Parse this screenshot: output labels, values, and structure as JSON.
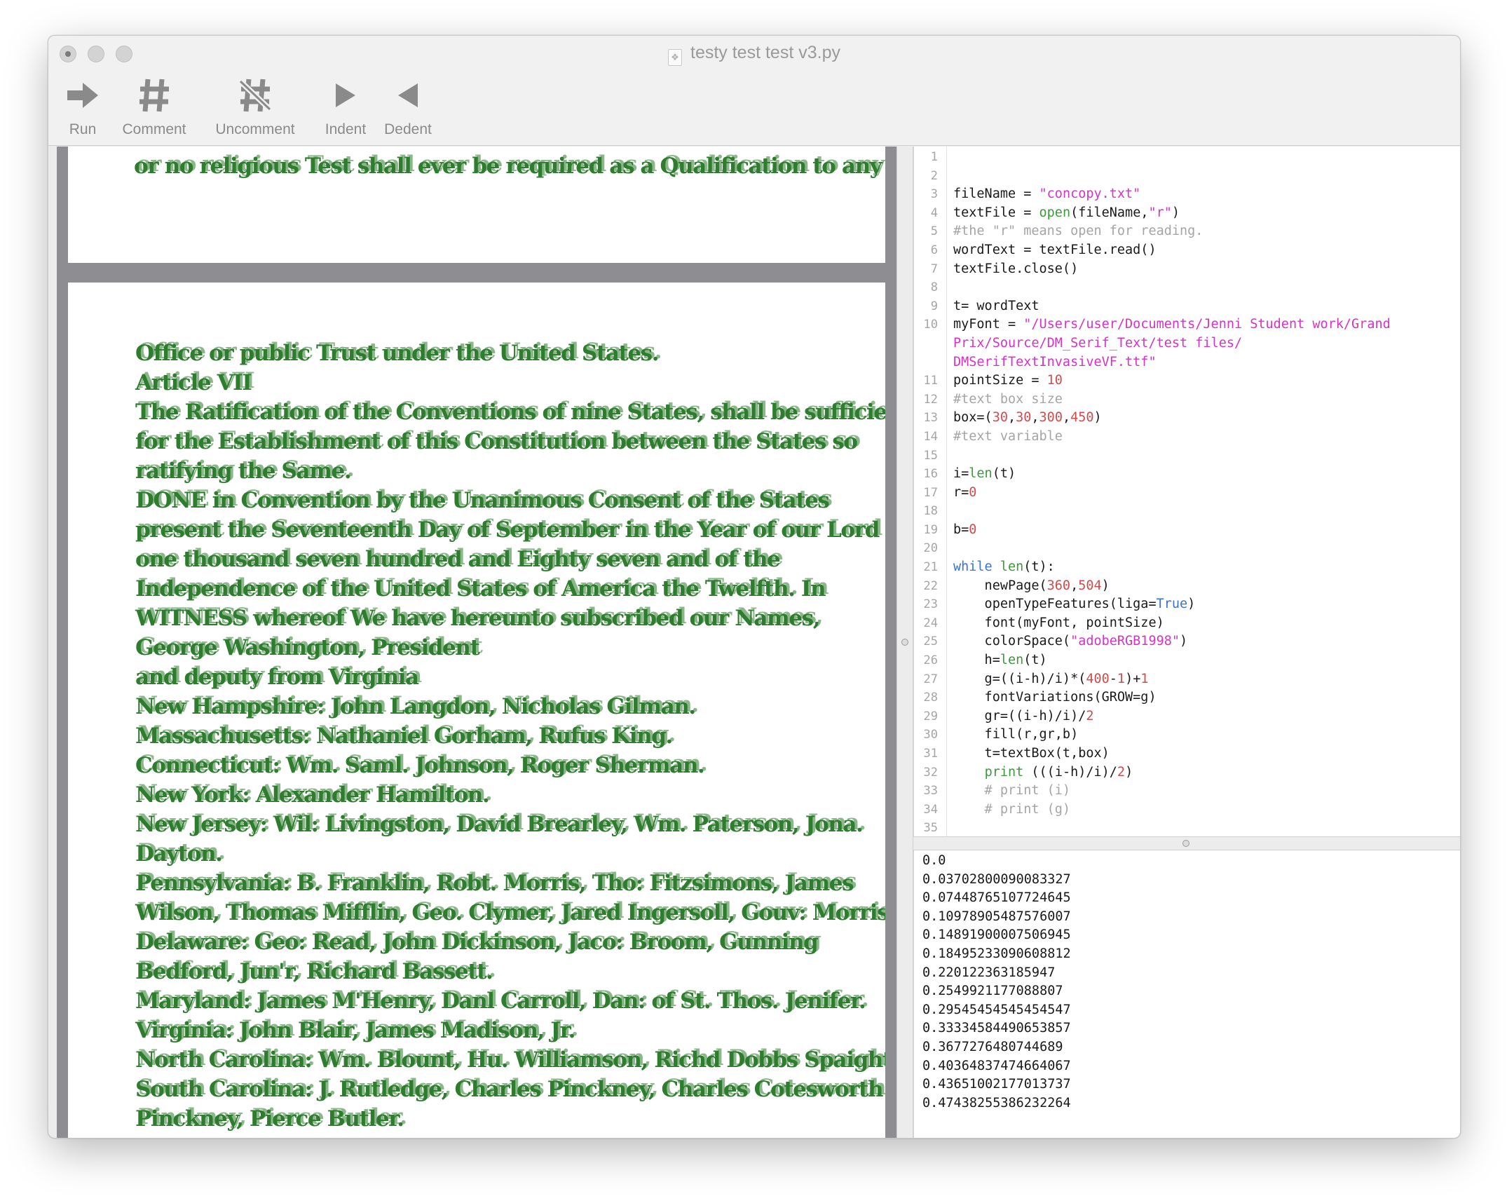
{
  "window": {
    "title": "testy test test v3.py"
  },
  "toolbar": {
    "run_label": "Run",
    "comment_label": "Comment",
    "uncomment_label": "Uncomment",
    "indent_label": "Indent",
    "dedent_label": "Dedent",
    "icons": [
      "run-arrow-icon",
      "comment-hash-icon",
      "uncomment-hash-icon",
      "indent-triangle-icon",
      "dedent-triangle-icon"
    ]
  },
  "canvas": {
    "text_color": "#2e7d2e",
    "page1_line": "or no religious Test shall ever be required as a Qualification to any",
    "page2_lines": [
      "Office or public Trust under the United States.",
      "Article VII",
      "The Ratification of the Conventions of nine States, shall be sufficient",
      "for the Establishment of this Constitution between the States so",
      "ratifying the Same.",
      "DONE in Convention by the Unanimous Consent of the States",
      "present the Seventeenth Day of September in the Year of our Lord",
      "one thousand seven hundred and Eighty seven and of the",
      "Independence of the United States of America the Twelfth. In",
      "WITNESS whereof We have hereunto subscribed our Names,",
      "George Washington, President",
      "and deputy from Virginia",
      "New Hampshire: John Langdon, Nicholas Gilman.",
      "Massachusetts: Nathaniel Gorham, Rufus King.",
      "Connecticut: Wm. Saml. Johnson, Roger Sherman.",
      "New York: Alexander Hamilton.",
      "New Jersey: Wil: Livingston, David Brearley, Wm. Paterson, Jona.",
      "Dayton.",
      "Pennsylvania: B. Franklin, Robt. Morris, Tho: Fitzsimons, James",
      "Wilson, Thomas Mifflin, Geo. Clymer, Jared Ingersoll, Gouv: Morris.",
      "Delaware: Geo: Read, John Dickinson, Jaco: Broom, Gunning",
      "Bedford, Jun'r, Richard Bassett.",
      "Maryland: James M'Henry, Danl Carroll, Dan: of St. Thos. Jenifer.",
      "Virginia: John Blair, James Madison, Jr.",
      "North Carolina: Wm. Blount, Hu. Williamson, Richd Dobbs Spaight.",
      "South Carolina: J. Rutledge, Charles Pinckney, Charles Cotesworth",
      "Pinckney, Pierce Butler."
    ]
  },
  "editor": {
    "colors": {
      "string": "#d633c6",
      "function": "#3b9a3b",
      "number": "#d14c4c",
      "keyword": "#3a72d8",
      "comment": "#a5a5a5"
    },
    "lines": [
      {
        "n": "1",
        "tokens": []
      },
      {
        "n": "2",
        "tokens": []
      },
      {
        "n": "3",
        "tokens": [
          {
            "t": "fileName = ",
            "c": ""
          },
          {
            "t": "\"concopy.txt\"",
            "c": "str"
          }
        ]
      },
      {
        "n": "4",
        "tokens": [
          {
            "t": "textFile = ",
            "c": ""
          },
          {
            "t": "open",
            "c": "fn"
          },
          {
            "t": "(fileName,",
            "c": ""
          },
          {
            "t": "\"r\"",
            "c": "str"
          },
          {
            "t": ")",
            "c": ""
          }
        ]
      },
      {
        "n": "5",
        "tokens": [
          {
            "t": "#the \"r\" means open for reading.",
            "c": "com"
          }
        ]
      },
      {
        "n": "6",
        "tokens": [
          {
            "t": "wordText = textFile.read()",
            "c": ""
          }
        ]
      },
      {
        "n": "7",
        "tokens": [
          {
            "t": "textFile.close()",
            "c": ""
          }
        ]
      },
      {
        "n": "8",
        "tokens": []
      },
      {
        "n": "9",
        "tokens": [
          {
            "t": "t= wordText",
            "c": ""
          }
        ]
      },
      {
        "n": "10",
        "tokens": [
          {
            "t": "myFont = ",
            "c": ""
          },
          {
            "t": "\"/Users/user/Documents/Jenni Student work/Grand",
            "c": "str"
          }
        ]
      },
      {
        "n": "",
        "tokens": [
          {
            "t": "Prix/Source/DM_Serif_Text/test files/",
            "c": "str"
          }
        ]
      },
      {
        "n": "",
        "tokens": [
          {
            "t": "DMSerifTextInvasiveVF.ttf\"",
            "c": "str"
          }
        ]
      },
      {
        "n": "11",
        "tokens": [
          {
            "t": "pointSize = ",
            "c": ""
          },
          {
            "t": "10",
            "c": "num"
          }
        ]
      },
      {
        "n": "12",
        "tokens": [
          {
            "t": "#text box size",
            "c": "com"
          }
        ]
      },
      {
        "n": "13",
        "tokens": [
          {
            "t": "box=(",
            "c": ""
          },
          {
            "t": "30",
            "c": "num"
          },
          {
            "t": ",",
            "c": ""
          },
          {
            "t": "30",
            "c": "num"
          },
          {
            "t": ",",
            "c": ""
          },
          {
            "t": "300",
            "c": "num"
          },
          {
            "t": ",",
            "c": ""
          },
          {
            "t": "450",
            "c": "num"
          },
          {
            "t": ")",
            "c": ""
          }
        ]
      },
      {
        "n": "14",
        "tokens": [
          {
            "t": "#text variable",
            "c": "com"
          }
        ]
      },
      {
        "n": "15",
        "tokens": []
      },
      {
        "n": "16",
        "tokens": [
          {
            "t": "i=",
            "c": ""
          },
          {
            "t": "len",
            "c": "fn"
          },
          {
            "t": "(t)",
            "c": ""
          }
        ]
      },
      {
        "n": "17",
        "tokens": [
          {
            "t": "r=",
            "c": ""
          },
          {
            "t": "0",
            "c": "num"
          }
        ]
      },
      {
        "n": "18",
        "tokens": []
      },
      {
        "n": "19",
        "tokens": [
          {
            "t": "b=",
            "c": ""
          },
          {
            "t": "0",
            "c": "num"
          }
        ]
      },
      {
        "n": "20",
        "tokens": []
      },
      {
        "n": "21",
        "tokens": [
          {
            "t": "while",
            "c": "kw"
          },
          {
            "t": " ",
            "c": ""
          },
          {
            "t": "len",
            "c": "fn"
          },
          {
            "t": "(t):",
            "c": ""
          }
        ]
      },
      {
        "n": "22",
        "tokens": [
          {
            "t": "    newPage(",
            "c": ""
          },
          {
            "t": "360",
            "c": "num"
          },
          {
            "t": ",",
            "c": ""
          },
          {
            "t": "504",
            "c": "num"
          },
          {
            "t": ")",
            "c": ""
          }
        ]
      },
      {
        "n": "23",
        "tokens": [
          {
            "t": "    openTypeFeatures(liga=",
            "c": ""
          },
          {
            "t": "True",
            "c": "kw"
          },
          {
            "t": ")",
            "c": ""
          }
        ]
      },
      {
        "n": "24",
        "tokens": [
          {
            "t": "    font(myFont, pointSize)",
            "c": ""
          }
        ]
      },
      {
        "n": "25",
        "tokens": [
          {
            "t": "    colorSpace(",
            "c": ""
          },
          {
            "t": "\"adobeRGB1998\"",
            "c": "str"
          },
          {
            "t": ")",
            "c": ""
          }
        ]
      },
      {
        "n": "26",
        "tokens": [
          {
            "t": "    h=",
            "c": ""
          },
          {
            "t": "len",
            "c": "fn"
          },
          {
            "t": "(t)",
            "c": ""
          }
        ]
      },
      {
        "n": "27",
        "tokens": [
          {
            "t": "    g=((i-h)/i)*(",
            "c": ""
          },
          {
            "t": "400",
            "c": "num"
          },
          {
            "t": "-",
            "c": ""
          },
          {
            "t": "1",
            "c": "num"
          },
          {
            "t": ")+",
            "c": ""
          },
          {
            "t": "1",
            "c": "num"
          }
        ]
      },
      {
        "n": "28",
        "tokens": [
          {
            "t": "    fontVariations(GROW=g)",
            "c": ""
          }
        ]
      },
      {
        "n": "29",
        "tokens": [
          {
            "t": "    gr=((i-h)/i)/",
            "c": ""
          },
          {
            "t": "2",
            "c": "num"
          }
        ]
      },
      {
        "n": "30",
        "tokens": [
          {
            "t": "    fill(r,gr,b)",
            "c": ""
          }
        ]
      },
      {
        "n": "31",
        "tokens": [
          {
            "t": "    t=textBox(t,box)",
            "c": ""
          }
        ]
      },
      {
        "n": "32",
        "tokens": [
          {
            "t": "    ",
            "c": ""
          },
          {
            "t": "print",
            "c": "fn"
          },
          {
            "t": " (((i-h)/i)/",
            "c": ""
          },
          {
            "t": "2",
            "c": "num"
          },
          {
            "t": ")",
            "c": ""
          }
        ]
      },
      {
        "n": "33",
        "tokens": [
          {
            "t": "    # print (i)",
            "c": "com"
          }
        ]
      },
      {
        "n": "34",
        "tokens": [
          {
            "t": "    # print (g)",
            "c": "com"
          }
        ]
      },
      {
        "n": "35",
        "tokens": []
      }
    ]
  },
  "output": {
    "lines": [
      "0.0",
      "0.03702800090083327",
      "0.07448765107724645",
      "0.10978905487576007",
      "0.14891900007506945",
      "0.18495233090608812",
      "0.220122363185947",
      "0.2549921177088807",
      "0.29545454545454547",
      "0.33334584490653857",
      "0.3677276480744689",
      "0.40364837474664067",
      "0.43651002177013737",
      "0.47438255386232264"
    ]
  }
}
